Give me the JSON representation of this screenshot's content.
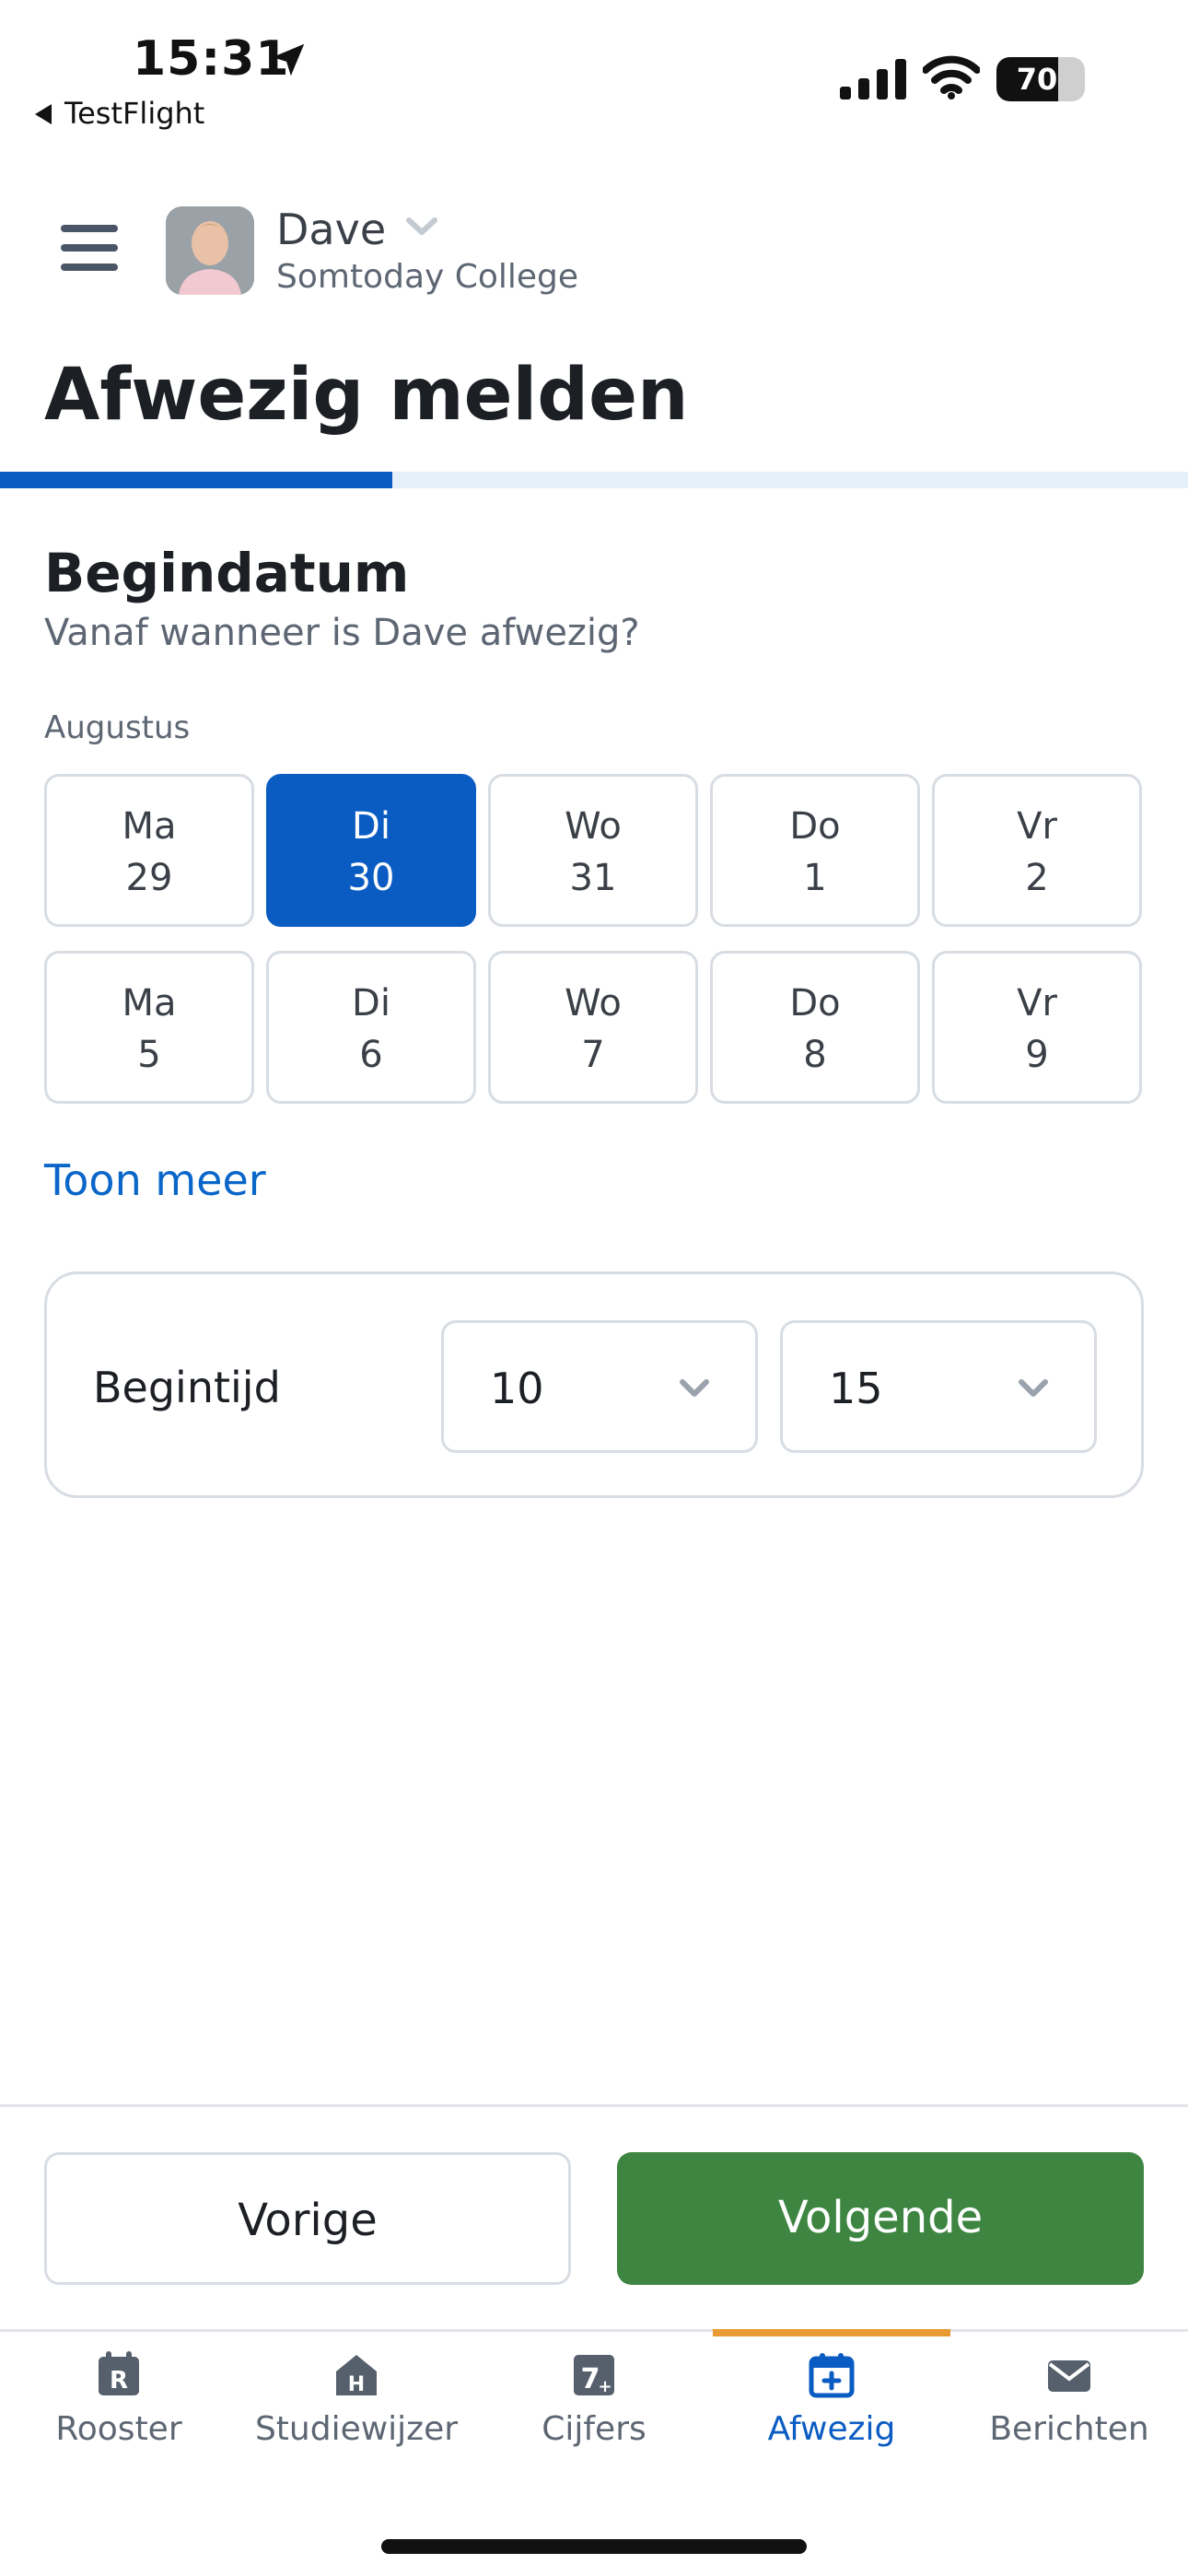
{
  "status_bar": {
    "time": "15:31",
    "back_app": "TestFlight",
    "battery": "70",
    "battery_level": 0.7
  },
  "header": {
    "user_name": "Dave",
    "school": "Somtoday College"
  },
  "page": {
    "title": "Afwezig melden",
    "progress": 0.33
  },
  "form": {
    "section_title": "Begindatum",
    "section_subtitle": "Vanaf wanneer is Dave afwezig?",
    "month": "Augustus",
    "days": [
      {
        "day": "Ma",
        "date": "29",
        "selected": false
      },
      {
        "day": "Di",
        "date": "30",
        "selected": true
      },
      {
        "day": "Wo",
        "date": "31",
        "selected": false
      },
      {
        "day": "Do",
        "date": "1",
        "selected": false
      },
      {
        "day": "Vr",
        "date": "2",
        "selected": false
      },
      {
        "day": "Ma",
        "date": "5",
        "selected": false
      },
      {
        "day": "Di",
        "date": "6",
        "selected": false
      },
      {
        "day": "Wo",
        "date": "7",
        "selected": false
      },
      {
        "day": "Do",
        "date": "8",
        "selected": false
      },
      {
        "day": "Vr",
        "date": "9",
        "selected": false
      }
    ],
    "show_more": "Toon meer",
    "time_label": "Begintijd",
    "hour": "10",
    "minute": "15"
  },
  "actions": {
    "previous": "Vorige",
    "next": "Volgende"
  },
  "tabs": [
    {
      "label": "Rooster",
      "icon": "rooster-icon",
      "active": false
    },
    {
      "label": "Studiewijzer",
      "icon": "studiewijzer-icon",
      "active": false
    },
    {
      "label": "Cijfers",
      "icon": "cijfers-icon",
      "active": false
    },
    {
      "label": "Afwezig",
      "icon": "calendar-plus-icon",
      "active": true
    },
    {
      "label": "Berichten",
      "icon": "envelope-icon",
      "active": false
    }
  ],
  "colors": {
    "primary": "#0a5cc2",
    "success": "#3d8541",
    "tab_indicator": "#e99a33"
  }
}
